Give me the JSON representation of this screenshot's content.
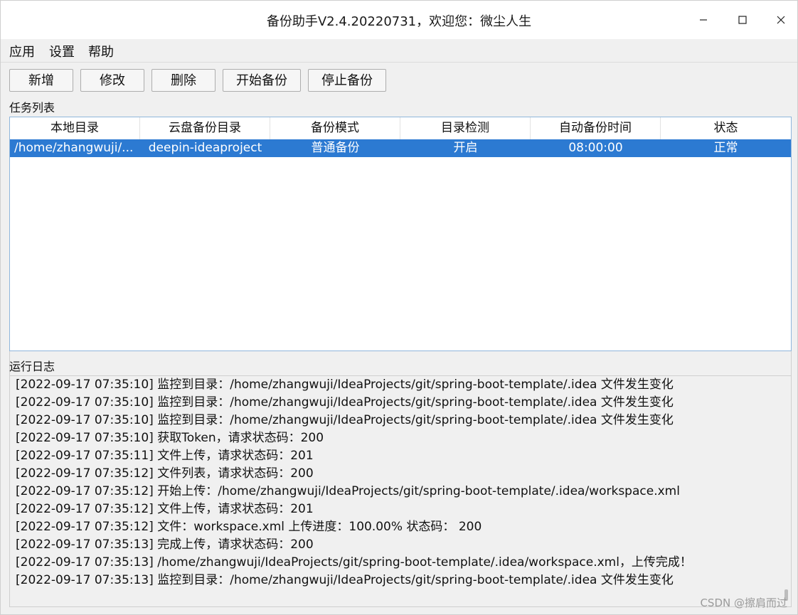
{
  "window": {
    "title": "备份助手V2.4.20220731，欢迎您：微尘人生"
  },
  "menu": {
    "items": [
      "应用",
      "设置",
      "帮助"
    ]
  },
  "toolbar": {
    "add_label": "新增",
    "edit_label": "修改",
    "delete_label": "删除",
    "start_label": "开始备份",
    "stop_label": "停止备份"
  },
  "task_list": {
    "label": "任务列表",
    "columns": [
      "本地目录",
      "云盘备份目录",
      "备份模式",
      "目录检测",
      "自动备份时间",
      "状态"
    ],
    "rows": [
      {
        "local_dir": "/home/zhangwuji/...",
        "cloud_dir": "deepin-ideaproject",
        "mode": "普通备份",
        "dir_check": "开启",
        "auto_time": "08:00:00",
        "status": "正常",
        "selected": true
      }
    ]
  },
  "log": {
    "label": "运行日志",
    "lines": [
      "[2022-09-17 07:35:10] 监控到目录：/home/zhangwuji/IdeaProjects/git/spring-boot-template/.idea 文件发生变化",
      "[2022-09-17 07:35:10] 监控到目录：/home/zhangwuji/IdeaProjects/git/spring-boot-template/.idea 文件发生变化",
      "[2022-09-17 07:35:10] 监控到目录：/home/zhangwuji/IdeaProjects/git/spring-boot-template/.idea 文件发生变化",
      "[2022-09-17 07:35:10] 获取Token，请求状态码：200",
      "[2022-09-17 07:35:11] 文件上传，请求状态码：201",
      "[2022-09-17 07:35:12] 文件列表，请求状态码：200",
      "[2022-09-17 07:35:12] 开始上传：/home/zhangwuji/IdeaProjects/git/spring-boot-template/.idea/workspace.xml",
      "[2022-09-17 07:35:12] 文件上传，请求状态码：201",
      "[2022-09-17 07:35:12] 文件：workspace.xml 上传进度：100.00% 状态码： 200",
      "[2022-09-17 07:35:13] 完成上传，请求状态码：200",
      "[2022-09-17 07:35:13] /home/zhangwuji/IdeaProjects/git/spring-boot-template/.idea/workspace.xml，上传完成！",
      "[2022-09-17 07:35:13] 监控到目录：/home/zhangwuji/IdeaProjects/git/spring-boot-template/.idea 文件发生变化"
    ]
  },
  "watermark": "CSDN @擦肩而过",
  "colors": {
    "selection": "#2c7ad2",
    "table_border": "#8fb6dc",
    "background": "#f0f0f0"
  },
  "icons": [
    "minimize-icon",
    "maximize-icon",
    "close-icon"
  ]
}
